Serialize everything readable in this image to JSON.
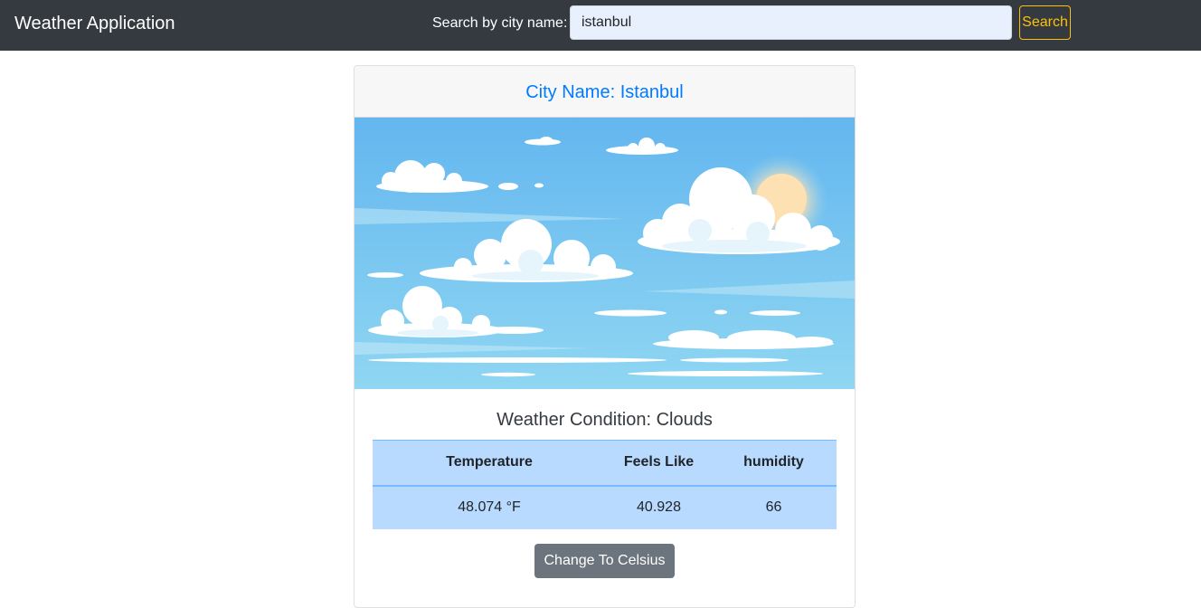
{
  "navbar": {
    "brand": "Weather Application",
    "search_label": "Search by city name:",
    "search_value": "istanbul",
    "search_button": "Search"
  },
  "card": {
    "city_title": "City Name: Istanbul",
    "image": "sky-with-clouds-illustration",
    "condition": "Weather Condition: Clouds",
    "table": {
      "headers": [
        "Temperature",
        "Feels Like",
        "humidity"
      ],
      "row": [
        "48.074 °F",
        "40.928",
        "66"
      ]
    },
    "convert_button": "Change To Celsius"
  },
  "colors": {
    "navbar_bg": "#343a40",
    "search_button": "#ffc107",
    "city_title": "#007bff",
    "table_bg": "#b8daff",
    "convert_button_bg": "#6c757d"
  }
}
